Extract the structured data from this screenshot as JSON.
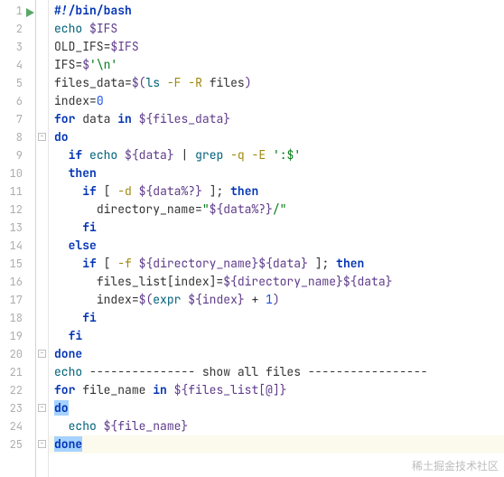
{
  "editor": {
    "line_count": 25,
    "run_marker_line": 1,
    "fold_markers": [
      8,
      20,
      23,
      25
    ],
    "highlighted_lines": [
      25
    ],
    "selected_tokens": [
      "do_23",
      "done_25"
    ]
  },
  "code": {
    "l1": {
      "shebang": "#!/bin/bash"
    },
    "l2": {
      "cmd": "echo",
      "var": "$IFS"
    },
    "l3": {
      "lhs": "OLD_IFS",
      "eq": "=",
      "var": "$IFS"
    },
    "l4": {
      "lhs": "IFS",
      "eq": "=",
      "dol": "$",
      "str": "'\\n'"
    },
    "l5": {
      "lhs": "files_data",
      "eq": "=",
      "open": "$(",
      "cmd": "ls",
      "opt1": "-F",
      "opt2": "-R",
      "arg": "files",
      "close": ")"
    },
    "l6": {
      "lhs": "index",
      "eq": "=",
      "num": "0"
    },
    "l7": {
      "kw_for": "for",
      "it": "data",
      "kw_in": "in",
      "var": "${files_data}"
    },
    "l8": {
      "kw_do": "do"
    },
    "l9": {
      "kw_if": "if",
      "cmd1": "echo",
      "var1": "${data}",
      "pipe": "|",
      "cmd2": "grep",
      "opt1": "-q",
      "opt2": "-E",
      "str": "':$'"
    },
    "l10": {
      "kw_then": "then"
    },
    "l11": {
      "kw_if": "if",
      "lb": "[",
      "opt": "-d",
      "var": "${data%?}",
      "rb": "]",
      "semi": ";",
      "kw_then": "then"
    },
    "l12": {
      "lhs": "directory_name",
      "eq": "=",
      "q1": "\"",
      "var": "${data%?}",
      "slash": "/",
      "q2": "\""
    },
    "l13": {
      "kw_fi": "fi"
    },
    "l14": {
      "kw_else": "else"
    },
    "l15": {
      "kw_if": "if",
      "lb": "[",
      "opt": "-f",
      "var1": "${directory_name}",
      "var2": "${data}",
      "rb": "]",
      "semi": ";",
      "kw_then": "then"
    },
    "l16": {
      "lhs": "files_list[index]",
      "eq": "=",
      "var1": "${directory_name}",
      "var2": "${data}"
    },
    "l17": {
      "lhs": "index",
      "eq": "=",
      "open": "$(",
      "cmd": "expr",
      "var": "${index}",
      "plus": "+",
      "num": "1",
      "close": ")"
    },
    "l18": {
      "kw_fi": "fi"
    },
    "l19": {
      "kw_fi": "fi"
    },
    "l20": {
      "kw_done": "done"
    },
    "l21": {
      "cmd": "echo",
      "txt": "--------------- show all files -----------------"
    },
    "l22": {
      "kw_for": "for",
      "it": "file_name",
      "kw_in": "in",
      "var": "${files_list[@]}"
    },
    "l23": {
      "kw_do": "do"
    },
    "l24": {
      "cmd": "echo",
      "var": "${file_name}"
    },
    "l25": {
      "kw_done": "done"
    }
  },
  "watermark": "稀土掘金技术社区"
}
